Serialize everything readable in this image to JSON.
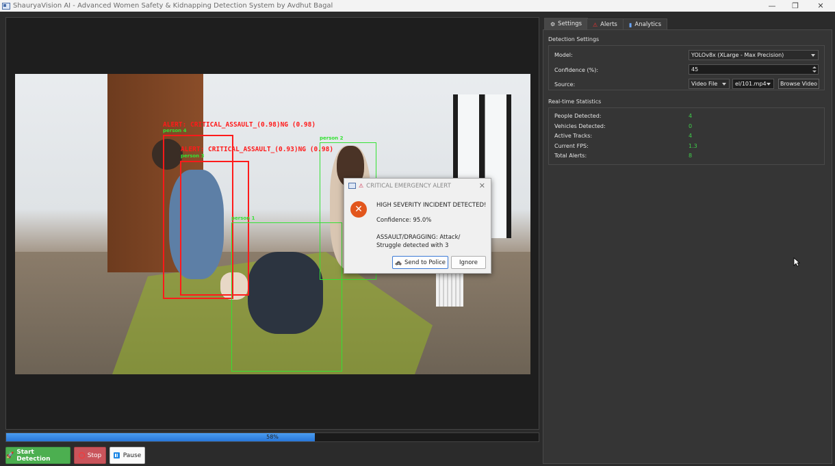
{
  "window": {
    "title": "ShauryaVision AI - Advanced Women Safety & Kidnapping Detection System by Avdhut Bagal",
    "minimize": "—",
    "maximize": "❐",
    "close": "✕"
  },
  "video": {
    "alerts": [
      {
        "text": "ALERT: CRITICAL_ASSAULT_(0.98)NG (0.98)"
      },
      {
        "text": "ALERT: CRITICAL_ASSAULT_(0.93)NG (0.98)"
      }
    ],
    "labels": {
      "person4": "person 4",
      "person3": "person 3",
      "person2": "person 2",
      "person1": "person 1"
    }
  },
  "progress": {
    "value": 58,
    "label": "58%"
  },
  "controls": {
    "start_label": "Start Detection",
    "stop_label": "Stop",
    "pause_label": "Pause"
  },
  "tabs": [
    {
      "label": "Settings",
      "icon": "gear-icon"
    },
    {
      "label": "Alerts",
      "icon": "alert-icon"
    },
    {
      "label": "Analytics",
      "icon": "chart-icon"
    }
  ],
  "settings": {
    "group_title": "Detection Settings",
    "model_label": "Model:",
    "model_value": "YOLOv8x (XLarge - Max Precision)",
    "confidence_label": "Confidence (%):",
    "confidence_value": "45",
    "source_label": "Source:",
    "source_type": "Video File",
    "source_file": "el/101.mp4",
    "browse_label": "Browse Video"
  },
  "stats": {
    "group_title": "Real-time Statistics",
    "rows": [
      {
        "label": "People Detected:",
        "value": "4"
      },
      {
        "label": "Vehicles Detected:",
        "value": "0"
      },
      {
        "label": "Active Tracks:",
        "value": "4"
      },
      {
        "label": "Current FPS:",
        "value": "1.3"
      },
      {
        "label": "Total Alerts:",
        "value": "8"
      }
    ]
  },
  "dialog": {
    "title": "CRITICAL EMERGENCY ALERT",
    "heading": "HIGH SEVERITY INCIDENT DETECTED!",
    "confidence": "Confidence: 95.0%",
    "message_line1": "ASSAULT/DRAGGING: Attack/",
    "message_line2": "Struggle detected with 3",
    "send_label": "Send to Police",
    "ignore_label": "Ignore"
  },
  "colors": {
    "alert_red": "#ff1a1a",
    "track_green": "#34e234",
    "accent_blue": "#2876d8",
    "start_green": "#4caf50",
    "stop_red": "#c9545b",
    "stat_green": "#3fd14a"
  }
}
